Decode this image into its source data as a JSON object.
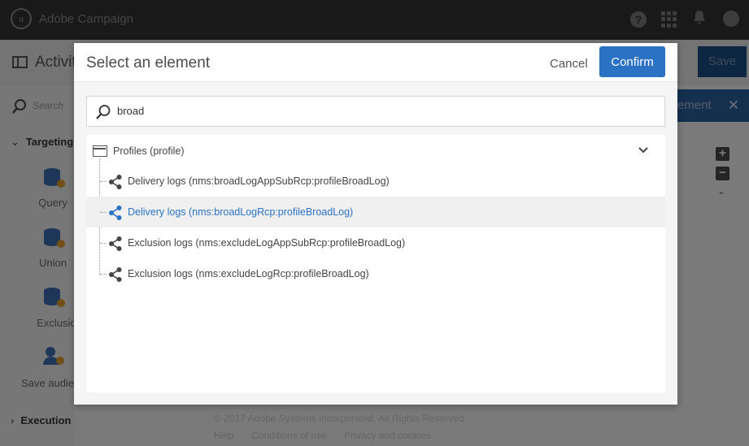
{
  "app": {
    "name": "Adobe Campaign",
    "logo_letter": "a"
  },
  "topbar_icons": [
    "help-icon",
    "apps-grid-icon",
    "bell-icon",
    "avatar"
  ],
  "background": {
    "page_title": "Activiti",
    "save_label": "Save",
    "search_placeholder": "Search",
    "element_chip_label": "ement",
    "sidebar_sections": {
      "targeting": "Targeting",
      "execution": "Execution"
    },
    "activities": [
      "Query",
      "Union",
      "Exclusion",
      "Save audien"
    ],
    "footer": {
      "copyright": "© 2017 Adobe Systems Incorporated. All Rights Reserved",
      "links": [
        "Help",
        "Conditions of use",
        "Privacy and cookies"
      ]
    }
  },
  "modal": {
    "title": "Select an element",
    "cancel_label": "Cancel",
    "confirm_label": "Confirm",
    "search": {
      "value": "broad"
    },
    "tree": {
      "root_label": "Profiles (profile)",
      "items": [
        {
          "label": "Delivery logs (nms:broadLogAppSubRcp:profileBroadLog)",
          "highlighted": false
        },
        {
          "label": "Delivery logs (nms:broadLogRcp:profileBroadLog)",
          "highlighted": true
        },
        {
          "label": "Exclusion logs (nms:excludeLogAppSubRcp:profileBroadLog)",
          "highlighted": false
        },
        {
          "label": "Exclusion logs (nms:excludeLogRcp:profileBroadLog)",
          "highlighted": false
        }
      ]
    }
  },
  "colors": {
    "topbar": "#323232",
    "primary_blue": "#2b72c4",
    "highlight_row": "#f0f0f0",
    "overlay": "rgba(0,0,0,0.5)"
  }
}
